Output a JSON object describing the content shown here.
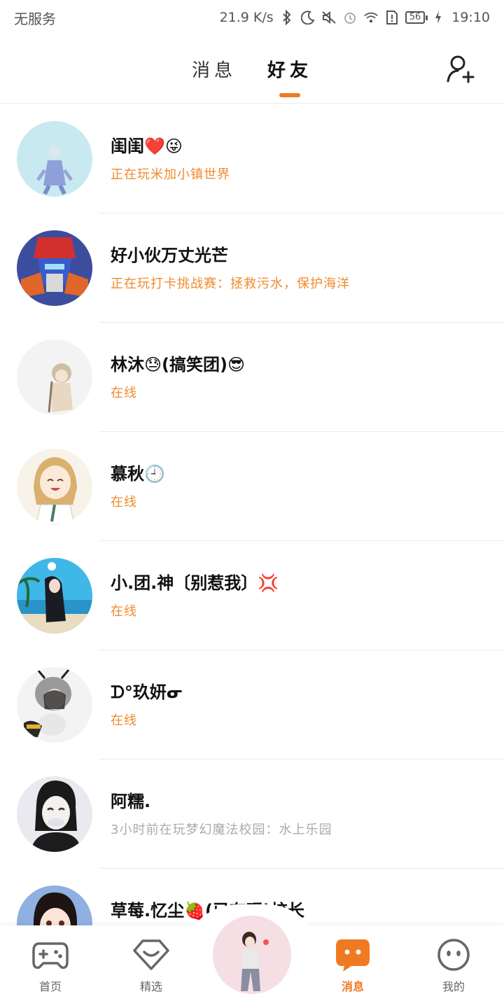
{
  "status_bar": {
    "carrier": "无服务",
    "speed": "21.9 K/s",
    "battery": "56",
    "time": "19:10"
  },
  "header": {
    "tabs": [
      {
        "label": "消息",
        "active": false
      },
      {
        "label": "好友",
        "active": true
      }
    ],
    "add_friend_icon": "add-user-icon"
  },
  "friends": [
    {
      "name": "闺闺❤️😜",
      "status": "正在玩米加小镇世界",
      "status_color": "orange"
    },
    {
      "name": "好小伙万丈光芒",
      "status": "正在玩打卡挑战赛：拯救污水，保护海洋",
      "status_color": "orange"
    },
    {
      "name": "林沐😓(搞笑团)😎",
      "status": "在线",
      "status_color": "orange"
    },
    {
      "name": "慕秋🕘",
      "status": "在线",
      "status_color": "orange"
    },
    {
      "name": "小.团.神〔别惹我〕💢",
      "status": "在线",
      "status_color": "orange"
    },
    {
      "name": "ᗪ°玖妍ᓂ",
      "status": "在线",
      "status_color": "orange"
    },
    {
      "name": "阿糯.",
      "status": "3小时前在玩梦幻魔法校园：水上乐园",
      "status_color": "gray"
    },
    {
      "name": "草莓.忆尘🍓(已有现)校长",
      "status": "",
      "status_color": "orange"
    }
  ],
  "bottom_nav": [
    {
      "label": "首页",
      "icon": "gamepad-icon"
    },
    {
      "label": "精选",
      "icon": "heart-diamond-icon"
    },
    {
      "label": "",
      "icon": "avatar-center"
    },
    {
      "label": "消息",
      "icon": "chat-bubble-icon",
      "active": true
    },
    {
      "label": "我的",
      "icon": "face-icon"
    }
  ],
  "colors": {
    "accent": "#f07a22",
    "status_orange": "#f08a2c",
    "status_gray": "#aaaaaa"
  }
}
